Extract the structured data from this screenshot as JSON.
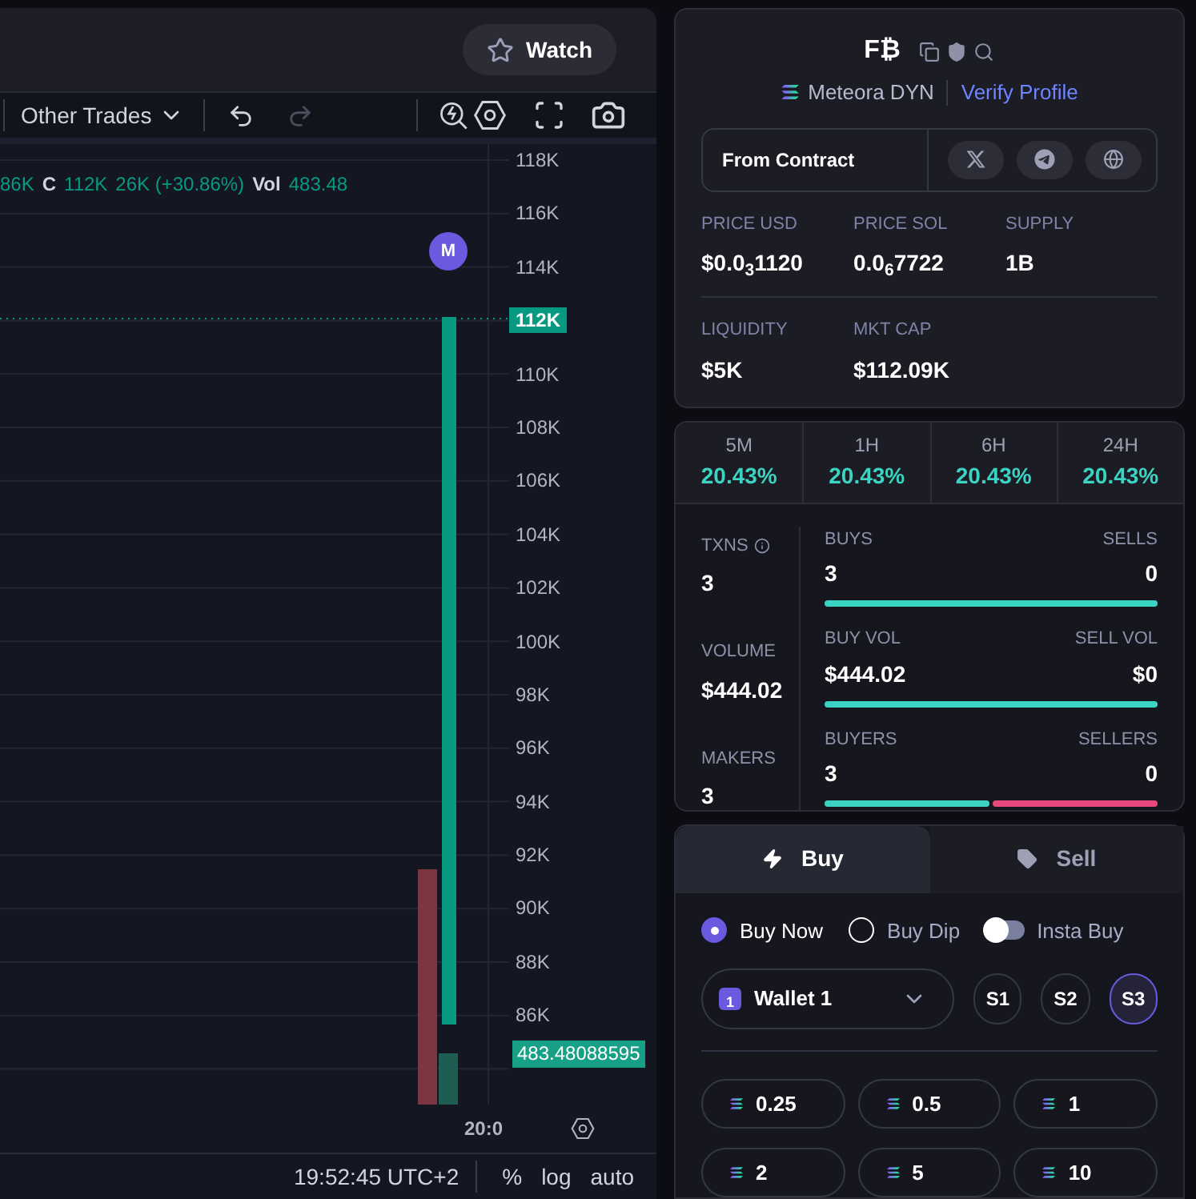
{
  "chart_header": {
    "watch_button": "Watch"
  },
  "toolbar": {
    "trades_dropdown": "Other Trades"
  },
  "legend": [
    {
      "kind": "value",
      "text": "86K"
    },
    {
      "kind": "label",
      "text": "C"
    },
    {
      "kind": "value",
      "text": "112K"
    },
    {
      "kind": "value",
      "text": "26K (+30.86%)"
    },
    {
      "kind": "label",
      "text": "Vol"
    },
    {
      "kind": "value",
      "text": "483.48"
    }
  ],
  "price_axis": [
    {
      "label": "118K",
      "highlighted": false
    },
    {
      "label": "116K",
      "highlighted": false
    },
    {
      "label": "114K",
      "highlighted": false
    },
    {
      "label": "112K",
      "highlighted": true
    },
    {
      "label": "110K",
      "highlighted": false
    },
    {
      "label": "108K",
      "highlighted": false
    },
    {
      "label": "106K",
      "highlighted": false
    },
    {
      "label": "104K",
      "highlighted": false
    },
    {
      "label": "102K",
      "highlighted": false
    },
    {
      "label": "100K",
      "highlighted": false
    },
    {
      "label": "98K",
      "highlighted": false
    },
    {
      "label": "96K",
      "highlighted": false
    },
    {
      "label": "94K",
      "highlighted": false
    },
    {
      "label": "92K",
      "highlighted": false
    },
    {
      "label": "90K",
      "highlighted": false
    },
    {
      "label": "88K",
      "highlighted": false
    },
    {
      "label": "86K",
      "highlighted": false
    }
  ],
  "marker": "M",
  "volume_label": "483.48088595",
  "time_axis": [
    "20:0"
  ],
  "bottom_bar": {
    "time": "19:52:45 UTC+2",
    "options": [
      "%",
      "log",
      "auto"
    ]
  },
  "token": {
    "logo": "F₿",
    "dex": "Meteora DYN",
    "verify_link": "Verify Profile",
    "contract_label": "From Contract",
    "stats": [
      [
        {
          "label": "PRICE USD",
          "value": "$0.0$_{3}$1120"
        },
        {
          "label": "PRICE SOL",
          "value": "0.0$_{6}$7722"
        },
        {
          "label": "SUPPLY",
          "value": "1B"
        }
      ],
      [
        {
          "label": "LIQUIDITY",
          "value": "$5K"
        },
        {
          "label": "MKT CAP",
          "value": "$112.09K"
        }
      ]
    ]
  },
  "periods": [
    {
      "label": "5M",
      "change": "20.43%"
    },
    {
      "label": "1H",
      "change": "20.43%"
    },
    {
      "label": "6H",
      "change": "20.43%"
    },
    {
      "label": "24H",
      "change": "20.43%"
    }
  ],
  "activity": {
    "summary": [
      {
        "label": "TXNS",
        "value": "3",
        "info": true
      },
      {
        "label": "VOLUME",
        "value": "$444.02",
        "info": false
      },
      {
        "label": "MAKERS",
        "value": "3",
        "info": false
      }
    ],
    "splits": [
      {
        "left_label": "BUYS",
        "right_label": "SELLS",
        "left_value": "3",
        "right_value": "0"
      },
      {
        "left_label": "BUY VOL",
        "right_label": "SELL VOL",
        "left_value": "$444.02",
        "right_value": "$0"
      },
      {
        "left_label": "BUYERS",
        "right_label": "SELLERS",
        "left_value": "3",
        "right_value": "0",
        "level": 0.5
      }
    ]
  },
  "trade": {
    "tabs": [
      {
        "label": "Buy",
        "selected": true
      },
      {
        "label": "Sell",
        "selected": false
      }
    ],
    "modes": [
      {
        "kind": "radio",
        "label": "Buy Now",
        "selected": true
      },
      {
        "kind": "radio",
        "label": "Buy Dip",
        "selected": false
      },
      {
        "kind": "toggle",
        "label": "Insta Buy",
        "on": false
      }
    ],
    "wallet": {
      "label": "Wallet 1",
      "badge": "1"
    },
    "presets": [
      {
        "label": "S1",
        "selected": false
      },
      {
        "label": "S2",
        "selected": false
      },
      {
        "label": "S3",
        "selected": true
      }
    ],
    "amounts": [
      "0.25",
      "0.5",
      "1",
      "2",
      "5",
      "10"
    ]
  }
}
